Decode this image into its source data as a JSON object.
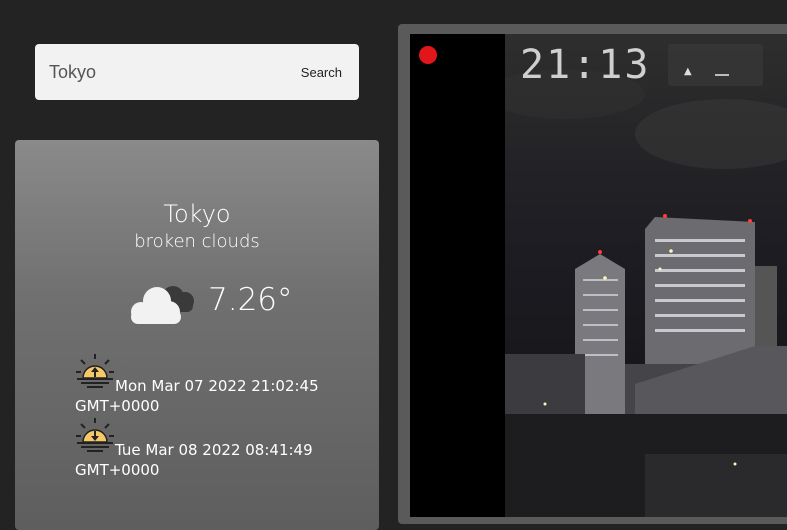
{
  "search": {
    "value": "Tokyo",
    "button_label": "Search"
  },
  "weather": {
    "city": "Tokyo",
    "condition": "broken clouds",
    "temperature": "7.26°",
    "icon": "cloud-icon",
    "sunrise": {
      "line1": "Mon Mar 07 2022 21:02:45",
      "line2": "GMT+0000",
      "icon": "sunrise-icon"
    },
    "sunset": {
      "line1": "Tue Mar 08 2022 08:41:49",
      "line2": "GMT+0000",
      "icon": "sunset-icon"
    }
  },
  "video": {
    "clock": "21:13",
    "live_color": "#e0161b"
  }
}
